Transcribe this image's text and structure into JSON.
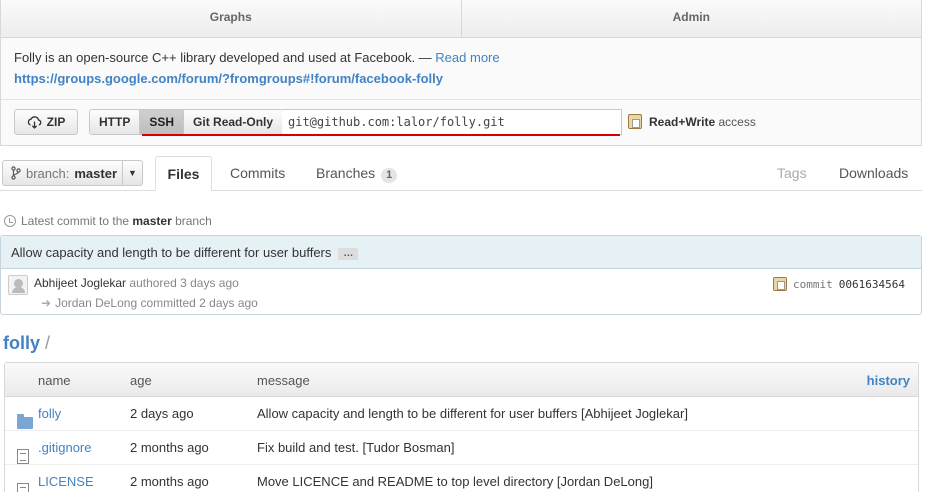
{
  "top_tabs": [
    "Graphs",
    "Admin"
  ],
  "description": {
    "text": "Folly is an open-source C++ library developed and used at Facebook. — ",
    "read_more": "Read more",
    "homepage": "https://groups.google.com/forum/?fromgroups#!forum/facebook-folly"
  },
  "clone": {
    "zip_label": "ZIP",
    "protocols": [
      "HTTP",
      "SSH",
      "Git Read-Only"
    ],
    "selected_protocol": "SSH",
    "url": "git@github.com:lalor/folly.git",
    "access_bold": "Read+Write",
    "access_text": " access"
  },
  "branch": {
    "label": "branch:",
    "name": "master"
  },
  "repo_tabs": {
    "files": "Files",
    "commits": "Commits",
    "branches": "Branches",
    "branches_count": "1",
    "tags": "Tags",
    "downloads": "Downloads"
  },
  "latest_commit": {
    "prefix": "Latest commit to the ",
    "branch": "master",
    "suffix": " branch"
  },
  "commit": {
    "message": "Allow capacity and length to be different for user buffers",
    "ellipsis": "…",
    "author": "Abhijeet Joglekar",
    "authored": " authored 3 days ago",
    "committer": "Jordan DeLong",
    "committed": " committed 2 days ago",
    "label": "commit",
    "sha": "0061634564"
  },
  "breadcrumb": {
    "root": "folly",
    "sep": " /"
  },
  "table": {
    "headers": {
      "name": "name",
      "age": "age",
      "message": "message",
      "history": "history"
    },
    "rows": [
      {
        "type": "folder",
        "name": "folly",
        "age": "2 days ago",
        "message": "Allow capacity and length to be different for user buffers [Abhijeet Joglekar]"
      },
      {
        "type": "file",
        "name": ".gitignore",
        "age": "2 months ago",
        "message": "Fix build and test. [Tudor Bosman]"
      },
      {
        "type": "file",
        "name": "LICENSE",
        "age": "2 months ago",
        "message": "Move LICENCE and README to top level directory [Jordan DeLong]"
      }
    ]
  },
  "colors": {
    "link": "#4183c4",
    "commit_bar": "#e6f1f6",
    "underline": "#d20000"
  }
}
